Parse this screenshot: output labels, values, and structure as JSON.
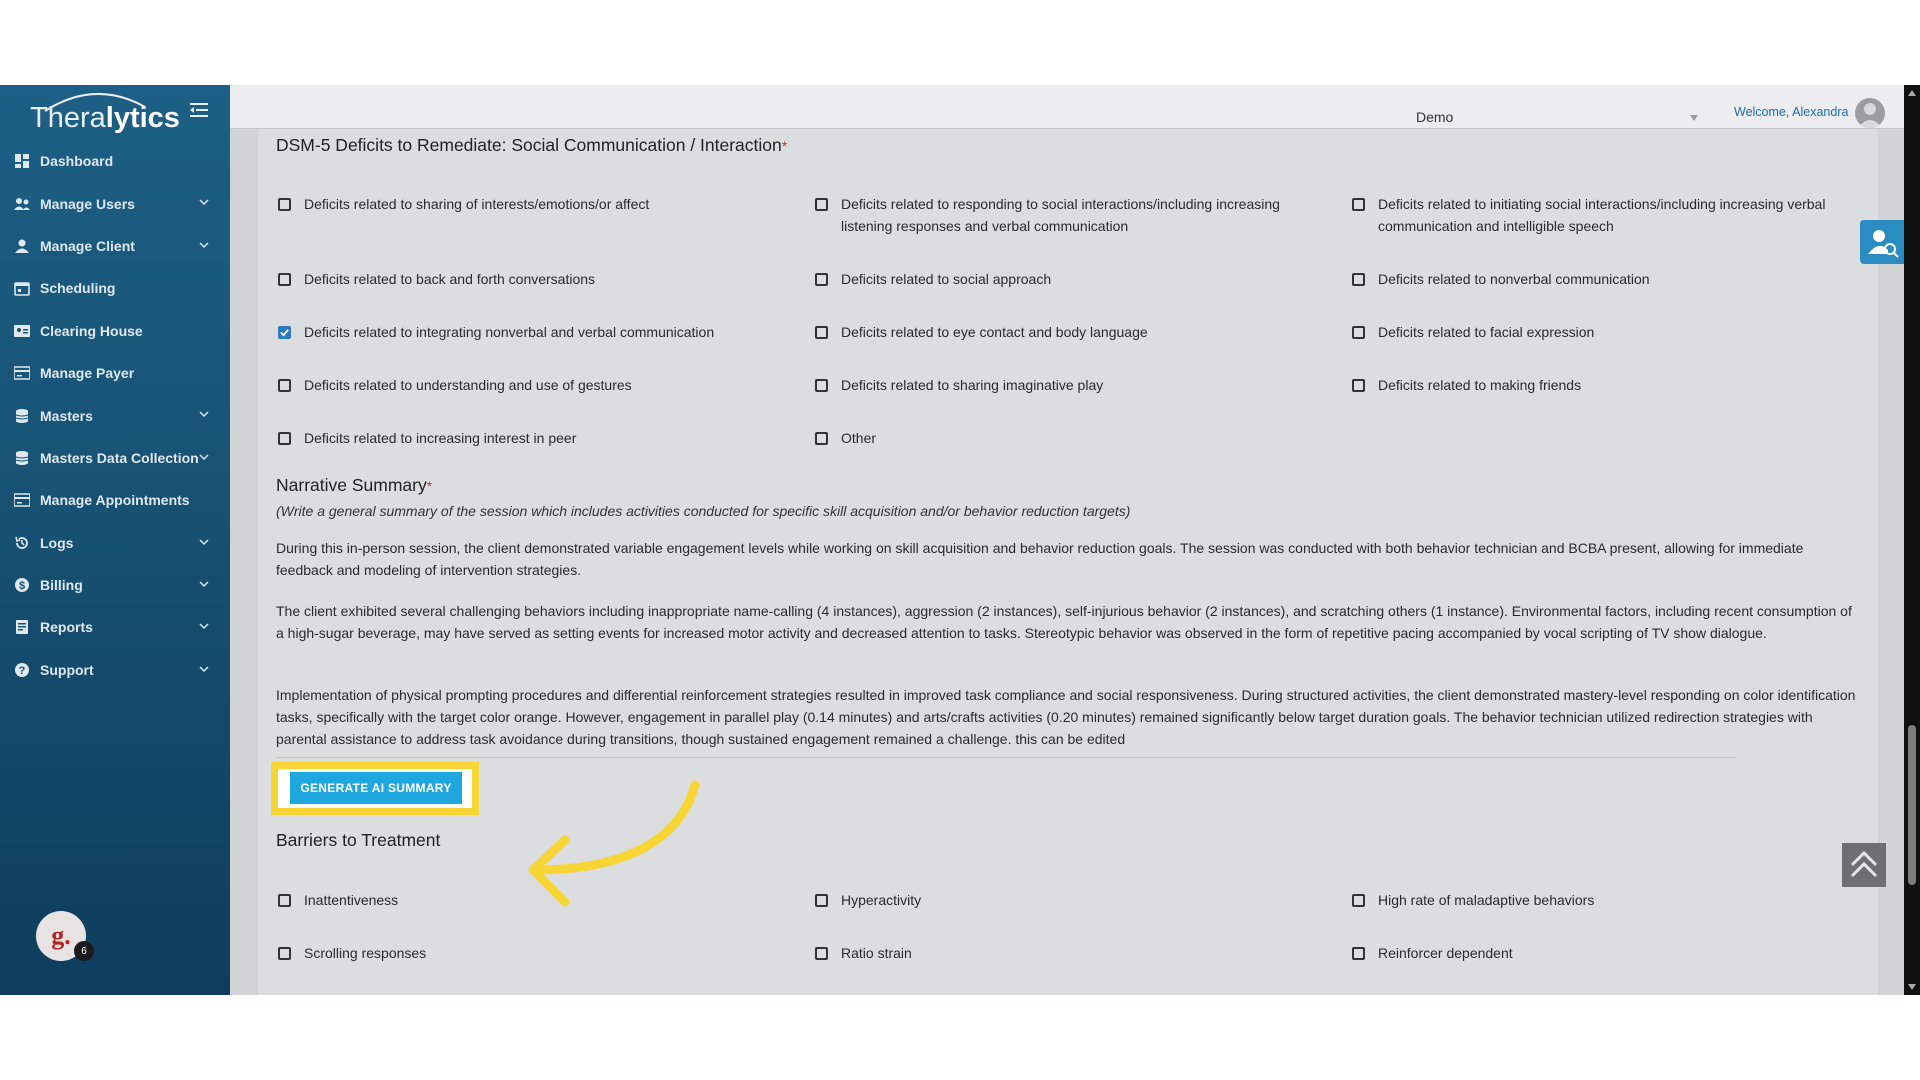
{
  "brand": {
    "name_part1": "Thera",
    "name_part2": "lytics"
  },
  "sidebar": {
    "items": [
      {
        "label": "Dashboard",
        "icon": "dashboard-icon",
        "chevron": false
      },
      {
        "label": "Manage Users",
        "icon": "users-icon",
        "chevron": true
      },
      {
        "label": "Manage Client",
        "icon": "client-icon",
        "chevron": true
      },
      {
        "label": "Scheduling",
        "icon": "calendar-icon",
        "chevron": false
      },
      {
        "label": "Clearing House",
        "icon": "id-card-icon",
        "chevron": false
      },
      {
        "label": "Manage Payer",
        "icon": "card-icon",
        "chevron": false
      },
      {
        "label": "Masters",
        "icon": "database-icon",
        "chevron": true
      },
      {
        "label": "Masters Data Collection",
        "icon": "database-icon",
        "chevron": true
      },
      {
        "label": "Manage Appointments",
        "icon": "card-icon",
        "chevron": false
      },
      {
        "label": "Logs",
        "icon": "history-icon",
        "chevron": true
      },
      {
        "label": "Billing",
        "icon": "dollar-icon",
        "chevron": true
      },
      {
        "label": "Reports",
        "icon": "report-icon",
        "chevron": true
      },
      {
        "label": "Support",
        "icon": "help-icon",
        "chevron": true
      }
    ],
    "badge_letter": "g.",
    "badge_count": "6"
  },
  "topbar": {
    "org_select": "Demo",
    "welcome": "Welcome, Alexandra"
  },
  "dsm": {
    "title": "DSM-5 Deficits to Remediate: Social Communication / Interaction",
    "required_mark": "*",
    "options": [
      {
        "label": "Deficits related to sharing of interests/emotions/or affect",
        "checked": false
      },
      {
        "label": "Deficits related to responding to social interactions/including increasing listening responses and verbal communication",
        "checked": false
      },
      {
        "label": "Deficits related to initiating social interactions/including increasing verbal communication and intelligible speech",
        "checked": false
      },
      {
        "label": "Deficits related to back and forth conversations",
        "checked": false
      },
      {
        "label": "Deficits related to social approach",
        "checked": false
      },
      {
        "label": "Deficits related to nonverbal communication",
        "checked": false
      },
      {
        "label": "Deficits related to integrating nonverbal and verbal communication",
        "checked": true
      },
      {
        "label": "Deficits related to eye contact and body language",
        "checked": false
      },
      {
        "label": "Deficits related to facial expression",
        "checked": false
      },
      {
        "label": "Deficits related to understanding and use of gestures",
        "checked": false
      },
      {
        "label": "Deficits related to sharing imaginative play",
        "checked": false
      },
      {
        "label": "Deficits related to making friends",
        "checked": false
      },
      {
        "label": "Deficits related to increasing interest in peer",
        "checked": false
      },
      {
        "label": "Other",
        "checked": false
      }
    ]
  },
  "narrative": {
    "title": "Narrative Summary",
    "required_mark": "*",
    "hint": "(Write a general summary of the session which includes activities conducted for specific skill acquisition and/or behavior reduction targets)",
    "paragraphs": [
      "During this in-person session, the client demonstrated variable engagement levels while working on skill acquisition and behavior reduction goals. The session was conducted with both behavior technician and BCBA present, allowing for immediate feedback and modeling of intervention strategies.",
      "The client exhibited several challenging behaviors including inappropriate name-calling (4 instances), aggression (2 instances), self-injurious behavior (2 instances), and scratching others (1 instance). Environmental factors, including recent consumption of a high-sugar beverage, may have served as setting events for increased motor activity and decreased attention to tasks. Stereotypic behavior was observed in the form of repetitive pacing accompanied by vocal scripting of TV show dialogue.",
      "Implementation of physical prompting procedures and differential reinforcement strategies resulted in improved task compliance and social responsiveness. During structured activities, the client demonstrated mastery-level responding on color identification tasks, specifically with the target color orange. However, engagement in parallel play (0.14 minutes) and arts/crafts activities (0.20 minutes) remained significantly below target duration goals. The behavior technician utilized redirection strategies with parental assistance to address task avoidance during transitions, though sustained engagement remained a challenge. this can be edited"
    ],
    "generate_button": "GENERATE AI SUMMARY"
  },
  "barriers": {
    "title": "Barriers to Treatment",
    "options": [
      {
        "label": "Inattentiveness",
        "checked": false
      },
      {
        "label": "Hyperactivity",
        "checked": false
      },
      {
        "label": "High rate of maladaptive behaviors",
        "checked": false
      },
      {
        "label": "Scrolling responses",
        "checked": false
      },
      {
        "label": "Ratio strain",
        "checked": false
      },
      {
        "label": "Reinforcer dependent",
        "checked": false
      }
    ]
  },
  "colors": {
    "sidebar": "#175274",
    "accent": "#1fa8e0",
    "highlight": "#f6d534",
    "checked": "#2d7bbf"
  }
}
